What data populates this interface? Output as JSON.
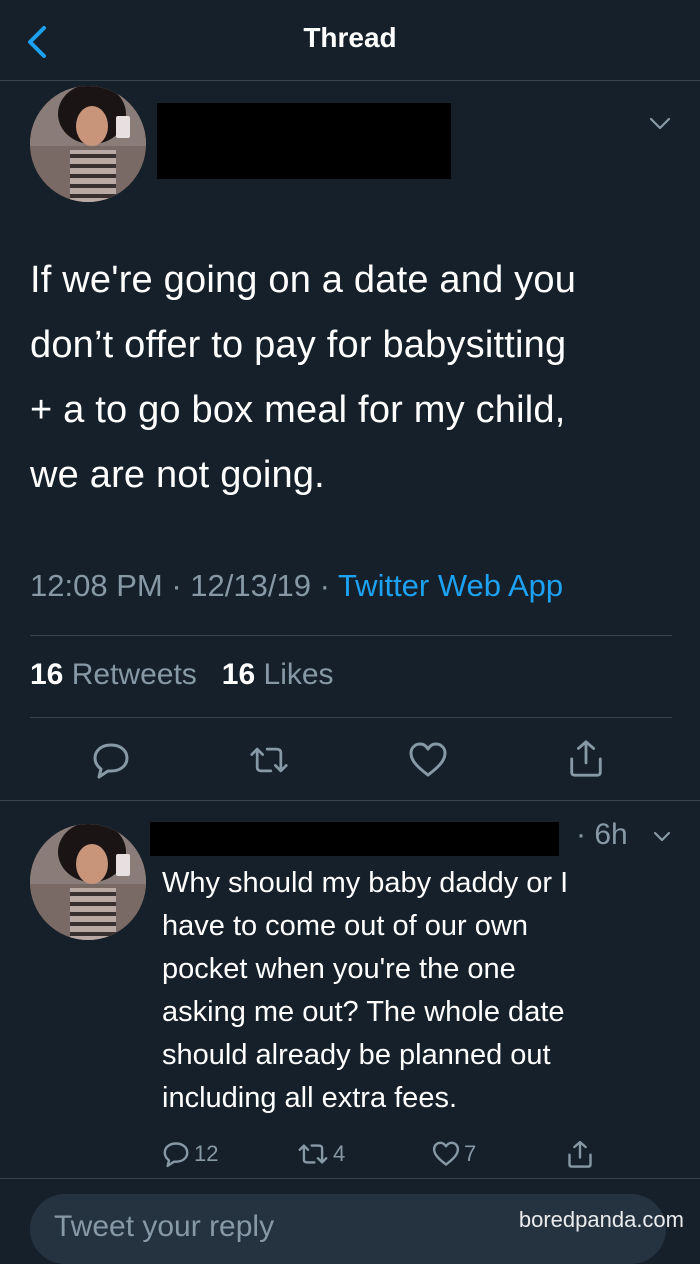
{
  "header": {
    "title": "Thread",
    "back_icon": "chevron-left-icon"
  },
  "tweet": {
    "text": "If we're going on a date and you\ndon’t offer to pay for babysitting\n+ a to go box meal for my child,\nwe are not going.",
    "time": "12:08 PM",
    "date": "12/13/19",
    "source": "Twitter Web App",
    "retweets_count": "16",
    "retweets_label": "Retweets",
    "likes_count": "16",
    "likes_label": "Likes"
  },
  "reply": {
    "time": "6h",
    "text": "Why should my baby daddy or I\nhave to come out of our own\npocket when you're the one\nasking me out? The whole date\nshould already be planned out\nincluding all extra fees.",
    "replies": "12",
    "retweets": "4",
    "likes": "7"
  },
  "compose": {
    "placeholder": "Tweet your reply"
  },
  "watermark": "boredpanda.com",
  "colors": {
    "background": "#15202b",
    "accent": "#1da1f2",
    "muted": "#8899a6",
    "divider": "#38444d"
  }
}
